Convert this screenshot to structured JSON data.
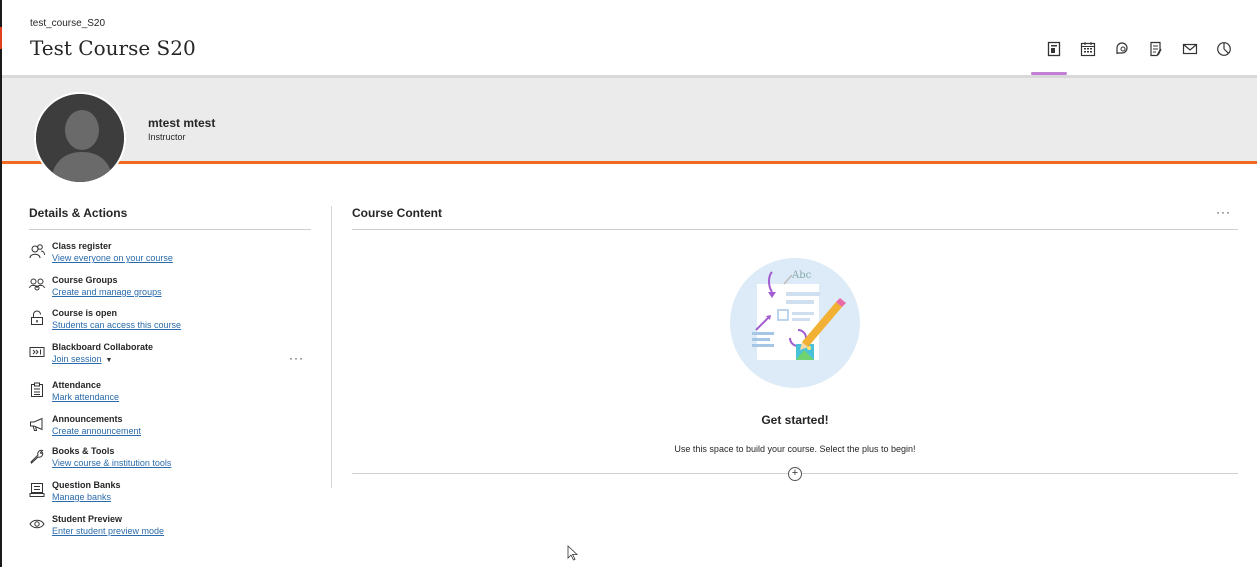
{
  "header": {
    "course_id": "test_course_S20",
    "course_title": "Test Course S20",
    "nav_icons": [
      "content-icon",
      "calendar-icon",
      "discussions-icon",
      "gradebook-icon",
      "messages-icon",
      "analytics-icon"
    ]
  },
  "profile": {
    "name": "mtest mtest",
    "role": "Instructor"
  },
  "details": {
    "title": "Details & Actions",
    "items": [
      {
        "title": "Class register",
        "link": "View everyone on your course",
        "icon": "people-icon"
      },
      {
        "title": "Course Groups",
        "link": "Create and manage groups",
        "icon": "groups-icon"
      },
      {
        "title": "Course is open",
        "link": "Students can access this course",
        "icon": "unlock-icon"
      },
      {
        "title": "Blackboard Collaborate",
        "link": "Join session",
        "icon": "collaborate-icon"
      },
      {
        "title": "Attendance",
        "link": "Mark attendance",
        "icon": "attendance-icon"
      },
      {
        "title": "Announcements",
        "link": "Create announcement",
        "icon": "megaphone-icon"
      },
      {
        "title": "Books & Tools",
        "link": "View course & institution tools",
        "icon": "wrench-icon"
      },
      {
        "title": "Question Banks",
        "link": "Manage banks",
        "icon": "question-bank-icon"
      },
      {
        "title": "Student Preview",
        "link": "Enter student preview mode",
        "icon": "eye-icon"
      }
    ],
    "more": "···"
  },
  "content": {
    "title": "Course Content",
    "more": "···",
    "empty_title": "Get started!",
    "empty_text": "Use this space to build your course. Select the plus to begin!",
    "add_symbol": "+",
    "illustration_text": "Abc"
  },
  "colors": {
    "accent_orange": "#f0691f",
    "nav_underline": "#c37fd4",
    "link_blue": "#2a6bab"
  }
}
